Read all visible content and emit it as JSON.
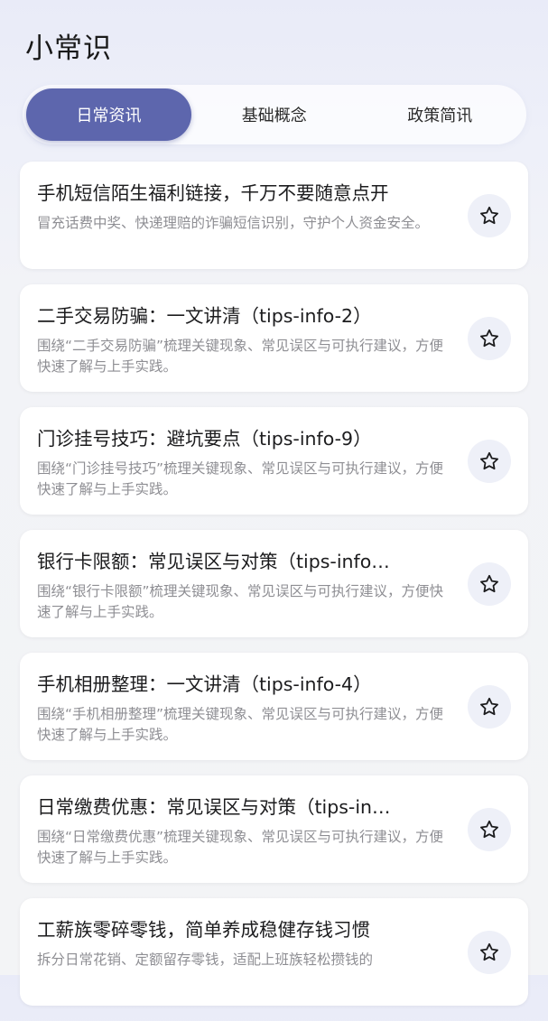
{
  "header": {
    "title": "小常识"
  },
  "tabs": [
    {
      "label": "日常资讯",
      "active": true
    },
    {
      "label": "基础概念",
      "active": false
    },
    {
      "label": "政策简讯",
      "active": false
    }
  ],
  "colors": {
    "accent": "#5d66ad",
    "favorite_bg": "#eef0f8",
    "title_text": "#1c1c1e",
    "desc_text": "#8e8e93"
  },
  "articles": [
    {
      "title": "手机短信陌生福利链接，千万不要随意点开",
      "desc": "冒充话费中奖、快递理赔的诈骗短信识别，守护个人资金安全。",
      "icon": "star-outline-icon"
    },
    {
      "title": "二手交易防骗：一文讲清（tips-info-2）",
      "desc": "围绕“二手交易防骗”梳理关键现象、常见误区与可执行建议，方便快速了解与上手实践。",
      "icon": "star-outline-icon"
    },
    {
      "title": "门诊挂号技巧：避坑要点（tips-info-9）",
      "desc": "围绕“门诊挂号技巧”梳理关键现象、常见误区与可执行建议，方便快速了解与上手实践。",
      "icon": "star-outline-icon"
    },
    {
      "title": "银行卡限额：常见误区与对策（tips-info…",
      "desc": "围绕“银行卡限额”梳理关键现象、常见误区与可执行建议，方便快速了解与上手实践。",
      "icon": "star-outline-icon"
    },
    {
      "title": "手机相册整理：一文讲清（tips-info-4）",
      "desc": "围绕“手机相册整理”梳理关键现象、常见误区与可执行建议，方便快速了解与上手实践。",
      "icon": "star-outline-icon"
    },
    {
      "title": "日常缴费优惠：常见误区与对策（tips-in…",
      "desc": "围绕“日常缴费优惠”梳理关键现象、常见误区与可执行建议，方便快速了解与上手实践。",
      "icon": "star-outline-icon"
    },
    {
      "title": "工薪族零碎零钱，简单养成稳健存钱习惯",
      "desc": "拆分日常花销、定额留存零钱，适配上班族轻松攒钱的",
      "icon": "star-outline-icon"
    }
  ]
}
